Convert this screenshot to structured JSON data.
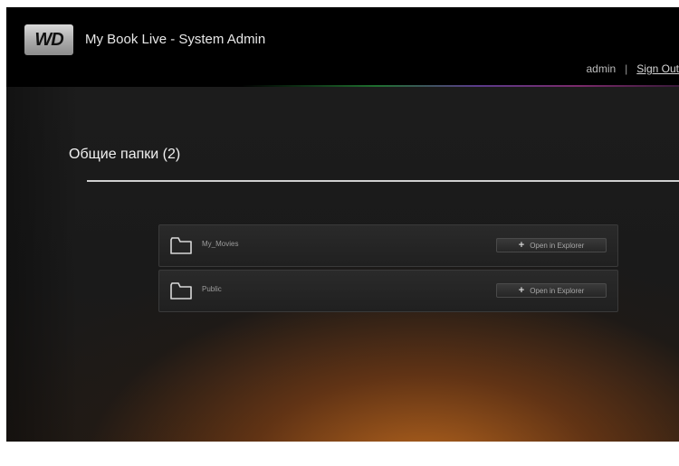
{
  "header": {
    "logo_text": "WD",
    "app_title": "My Book Live - System Admin",
    "user": "admin",
    "separator": "|",
    "sign_out": "Sign Out"
  },
  "page": {
    "title": "Общие папки (2)"
  },
  "folders": [
    {
      "name": "My_Movies",
      "action_label": "Open in Explorer",
      "icon": "folder-icon"
    },
    {
      "name": "Public",
      "action_label": "Open in Explorer",
      "icon": "folder-icon"
    }
  ],
  "colors": {
    "header_bg": "#000000",
    "body_bg": "#1a1a1a",
    "glow": "#be691e"
  }
}
